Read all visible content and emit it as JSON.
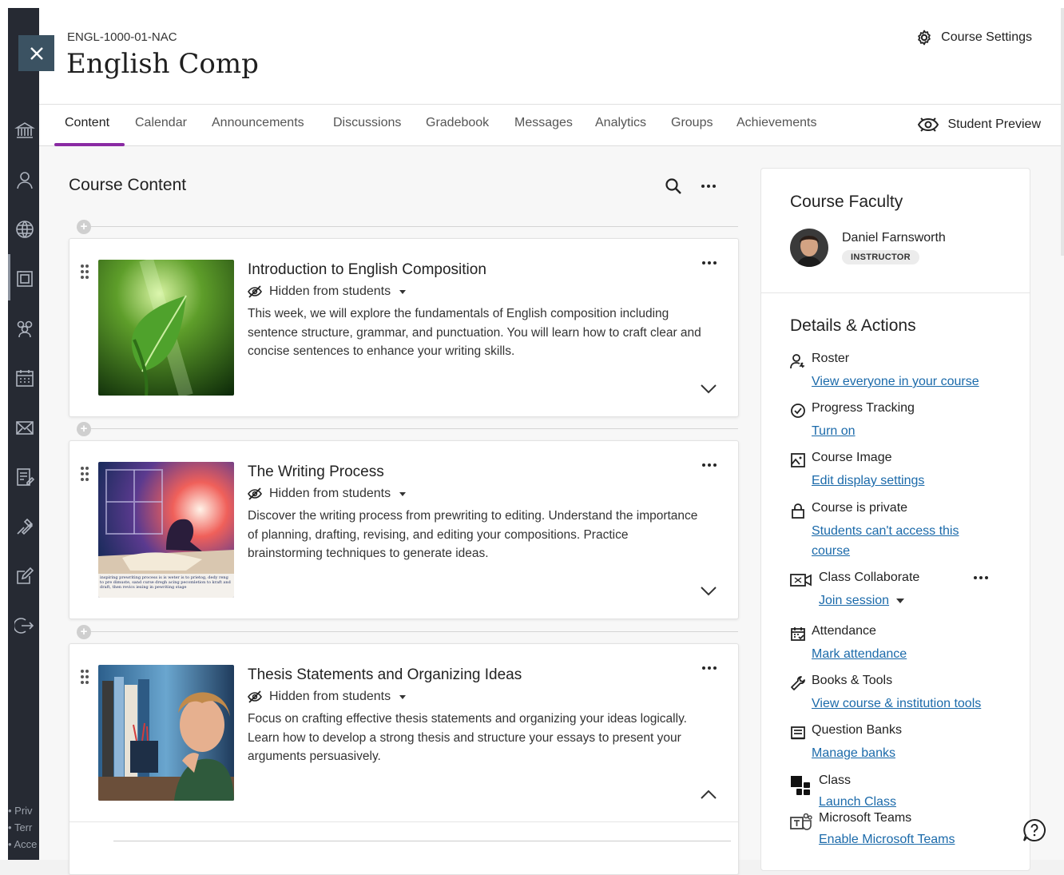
{
  "course": {
    "code": "ENGL-1000-01-NAC",
    "title": "English Comp",
    "settings_label": "Course Settings",
    "student_preview_label": "Student Preview"
  },
  "tabs": [
    {
      "label": "Content",
      "active": true
    },
    {
      "label": "Calendar"
    },
    {
      "label": "Announcements"
    },
    {
      "label": "Discussions"
    },
    {
      "label": "Gradebook"
    },
    {
      "label": "Messages"
    },
    {
      "label": "Analytics"
    },
    {
      "label": "Groups"
    },
    {
      "label": "Achievements"
    }
  ],
  "content": {
    "title": "Course Content",
    "items": [
      {
        "title": "Introduction to English Composition",
        "visibility": "Hidden from students",
        "description": "This week, we will explore the fundamentals of English composition including sentence structure, grammar, and punctuation. You will learn how to craft clear and concise sentences to enhance your writing skills.",
        "expanded": false
      },
      {
        "title": "The Writing Process",
        "visibility": "Hidden from students",
        "description": "Discover the writing process from prewriting to editing. Understand the importance of planning, drafting, revising, and editing your compositions. Practice brainstorming techniques to generate ideas.",
        "thumb_caption": "inspiring prewriting process is is weter is to prietog, dedy reng to pre dimuste, sand curse dregh acing pecomletion to kraft and draft, then revics iexing in pewriting stage",
        "expanded": false
      },
      {
        "title": "Thesis Statements and Organizing Ideas",
        "visibility": "Hidden from students",
        "description": "Focus on crafting effective thesis statements and organizing your ideas logically. Learn how to develop a strong thesis and structure your essays to present your arguments persuasively.",
        "expanded": true
      }
    ]
  },
  "sidebar": {
    "faculty_title": "Course Faculty",
    "faculty_name": "Daniel Farnsworth",
    "faculty_role": "INSTRUCTOR",
    "details_title": "Details & Actions",
    "items": [
      {
        "icon": "roster-icon",
        "label": "Roster",
        "link": "View everyone in your course"
      },
      {
        "icon": "progress-check-icon",
        "label": "Progress Tracking",
        "link": "Turn on"
      },
      {
        "icon": "image-icon",
        "label": "Course Image",
        "link": "Edit display settings"
      },
      {
        "icon": "lock-icon",
        "label": "Course is private",
        "link_line1": "Students can't access this",
        "link_line2": "course"
      },
      {
        "icon": "video-camera-icon",
        "label": "Class Collaborate",
        "link": "Join session"
      },
      {
        "icon": "calendar-check-icon",
        "label": "Attendance",
        "link": "Mark attendance"
      },
      {
        "icon": "wrench-icon",
        "label": "Books & Tools",
        "link": "View course & institution tools"
      },
      {
        "icon": "question-bank-icon",
        "label": "Question Banks",
        "link": "Manage banks"
      },
      {
        "icon": "class-app-icon",
        "label": "Class",
        "link": "Launch Class"
      },
      {
        "icon": "teams-icon",
        "label": "Microsoft Teams",
        "link": "Enable Microsoft Teams"
      }
    ]
  },
  "footer": {
    "links": [
      "Priv",
      "Terr",
      "Acce"
    ]
  },
  "colors": {
    "accent": "#8a2aa3",
    "link": "#1b6aaa",
    "rail": "#262a33",
    "close_button": "#3b5262"
  }
}
